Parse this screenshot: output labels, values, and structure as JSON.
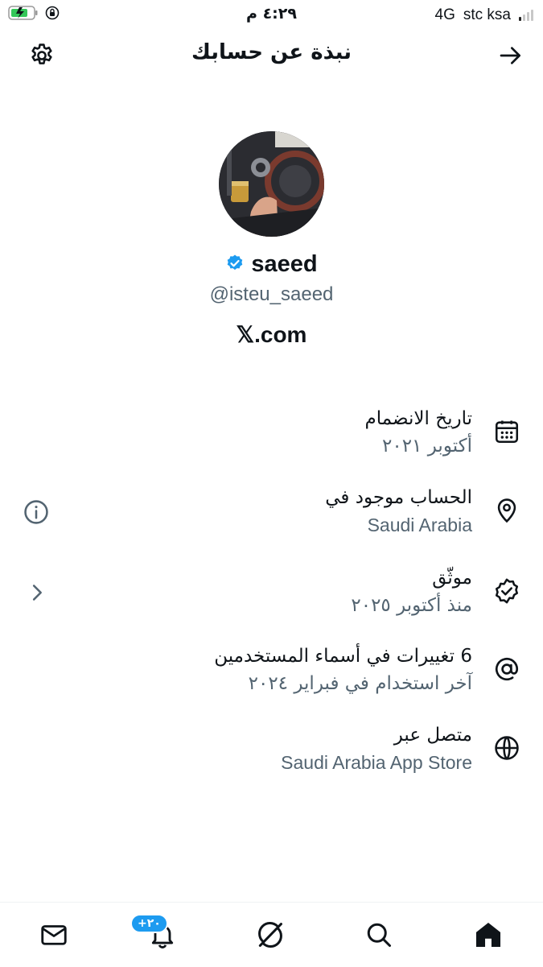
{
  "status_bar": {
    "time": "٤:٢٩ م",
    "network": "4G",
    "carrier": "stc ksa"
  },
  "header": {
    "title": "نبذة عن حسابك",
    "back_icon": "arrow-right-icon",
    "settings_icon": "gear-icon"
  },
  "profile": {
    "name": "saeed",
    "verified": true,
    "handle": "@isteu_saeed",
    "site": "𝕏.com",
    "accent_color": "#1d9bf0"
  },
  "info_rows": [
    {
      "title": "تاريخ الانضمام",
      "value": "أكتوبر ٢٠٢١",
      "icon": "calendar-icon"
    },
    {
      "title": "الحساب موجود في",
      "value": "Saudi Arabia",
      "icon": "location-pin-icon",
      "side_icon": "info-icon"
    },
    {
      "title": "موثّق",
      "value": "منذ أكتوبر ٢٠٢٥",
      "icon": "verified-badge-icon",
      "side_icon": "chevron-left-icon"
    },
    {
      "title": "6 تغييرات في أسماء المستخدمين",
      "value": "آخر استخدام في فبراير ٢٠٢٤",
      "icon": "at-sign-icon"
    },
    {
      "title": "متصل عبر",
      "value": "Saudi Arabia App Store",
      "icon": "globe-icon"
    }
  ],
  "bottom_nav": {
    "notifications_badge": "+٢٠",
    "items": [
      "mail-icon",
      "bell-icon",
      "grok-icon",
      "search-icon",
      "home-icon"
    ]
  }
}
